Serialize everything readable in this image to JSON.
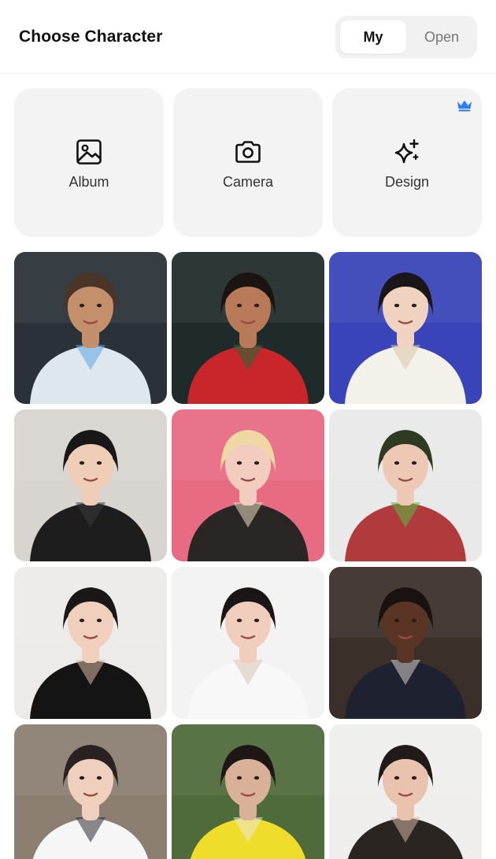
{
  "header": {
    "title": "Choose Character",
    "tabs": [
      {
        "label": "My",
        "selected": true
      },
      {
        "label": "Open",
        "selected": false
      }
    ]
  },
  "actions": [
    {
      "label": "Album",
      "icon": "image-icon"
    },
    {
      "label": "Camera",
      "icon": "camera-icon"
    },
    {
      "label": "Design",
      "icon": "sparkle-icon",
      "badge": "crown-icon",
      "badge_color": "#2f7df6"
    }
  ],
  "characters": [
    {
      "name": "character-photo-1",
      "palette": {
        "bg": "#2a3138",
        "subject": "#dfe7ee",
        "accent": "#5aa6e0",
        "skin": "#c48f6b",
        "hair": "#4a3528"
      }
    },
    {
      "name": "character-photo-2",
      "palette": {
        "bg": "#1f2b2a",
        "subject": "#c8262b",
        "accent": "#1c6e3a",
        "skin": "#b87a58",
        "hair": "#1a1512"
      }
    },
    {
      "name": "character-photo-3",
      "palette": {
        "bg": "#3944b8",
        "subject": "#f4f1ea",
        "accent": "#d9c7a8",
        "skin": "#f0d2c0",
        "hair": "#1b1618"
      }
    },
    {
      "name": "character-photo-4",
      "palette": {
        "bg": "#d8d4d0",
        "subject": "#1e1d1e",
        "accent": "#3a3a3c",
        "skin": "#efcdb6",
        "hair": "#1a1718"
      }
    },
    {
      "name": "character-photo-5",
      "palette": {
        "bg": "#e76b83",
        "subject": "#2a2624",
        "accent": "#e9dcc4",
        "skin": "#f2cdbf",
        "hair": "#f0d8a4"
      }
    },
    {
      "name": "character-photo-6",
      "palette": {
        "bg": "#e9e9ea",
        "subject": "#b13a3c",
        "accent": "#58c041",
        "skin": "#edc9b5",
        "hair": "#2e3a22"
      }
    },
    {
      "name": "character-photo-7",
      "palette": {
        "bg": "#ecebea",
        "subject": "#141414",
        "accent": "#d8b8a2",
        "skin": "#f1cfbd",
        "hair": "#1b1717"
      }
    },
    {
      "name": "character-photo-8",
      "palette": {
        "bg": "#f3f3f3",
        "subject": "#f8f8f8",
        "accent": "#d9c4b2",
        "skin": "#f0cdbc",
        "hair": "#1a1616"
      }
    },
    {
      "name": "character-photo-9",
      "palette": {
        "bg": "#3b2f2a",
        "subject": "#1e2130",
        "accent": "#d8d3cd",
        "skin": "#5a3424",
        "hair": "#1a1210"
      }
    },
    {
      "name": "character-photo-10",
      "palette": {
        "bg": "#8c7f72",
        "subject": "#f6f6f6",
        "accent": "#2b2b33",
        "skin": "#efcfbd",
        "hair": "#2a2220"
      }
    },
    {
      "name": "character-photo-11",
      "palette": {
        "bg": "#4f6b3b",
        "subject": "#f0dc2a",
        "accent": "#ecead8",
        "skin": "#d9b098",
        "hair": "#1d1715"
      }
    },
    {
      "name": "character-photo-12",
      "palette": {
        "bg": "#efeeec",
        "subject": "#2b2522",
        "accent": "#d2b6a6",
        "skin": "#e9c3ae",
        "hair": "#201a18"
      }
    }
  ]
}
